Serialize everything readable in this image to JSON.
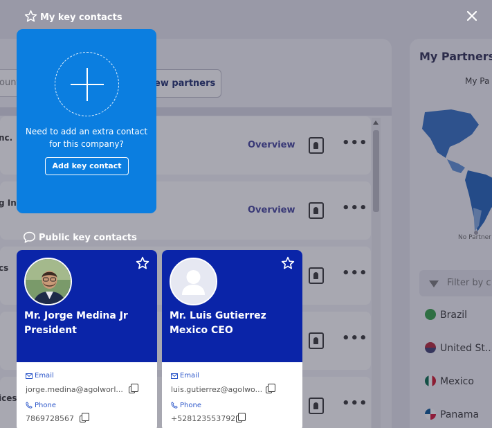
{
  "background": {
    "search_placeholder": "ount",
    "new_partners_label": "ew partners",
    "rows": [
      {
        "name": "nc.",
        "overview": "Overview"
      },
      {
        "name": "g In",
        "overview": "Overview"
      },
      {
        "name": "cs",
        "overview": ""
      },
      {
        "name": "",
        "overview": ""
      },
      {
        "name": "ices",
        "overview": ""
      }
    ],
    "right_panel": {
      "title": "My Partners l",
      "subtitle": "My Pa",
      "no_partner": "No Partner",
      "filter_placeholder": "Filter by c",
      "countries": [
        "Brazil",
        "United St...",
        "Mexico",
        "Panama"
      ]
    }
  },
  "modal": {
    "my_key_contacts_title": "My key contacts",
    "add_card": {
      "text": "Need to add an extra contact for this company?",
      "button_label": "Add key contact"
    },
    "public_key_contacts_title": "Public key contacts",
    "contacts": [
      {
        "name": "Mr. Jorge Medina Jr",
        "role": "President",
        "email_label": "Email",
        "email": "jorge.medina@agolworl...",
        "phone_label": "Phone",
        "phone": "7869728567"
      },
      {
        "name": "Mr. Luis Gutierrez",
        "role": "Mexico CEO",
        "email_label": "Email",
        "email": "luis.gutierrez@agolwo...",
        "phone_label": "Phone",
        "phone": "+528123553792"
      }
    ]
  },
  "colors": {
    "add_card": "#0b7ee0",
    "contact_card_header": "#0a24a8",
    "link": "#2a55c9"
  }
}
